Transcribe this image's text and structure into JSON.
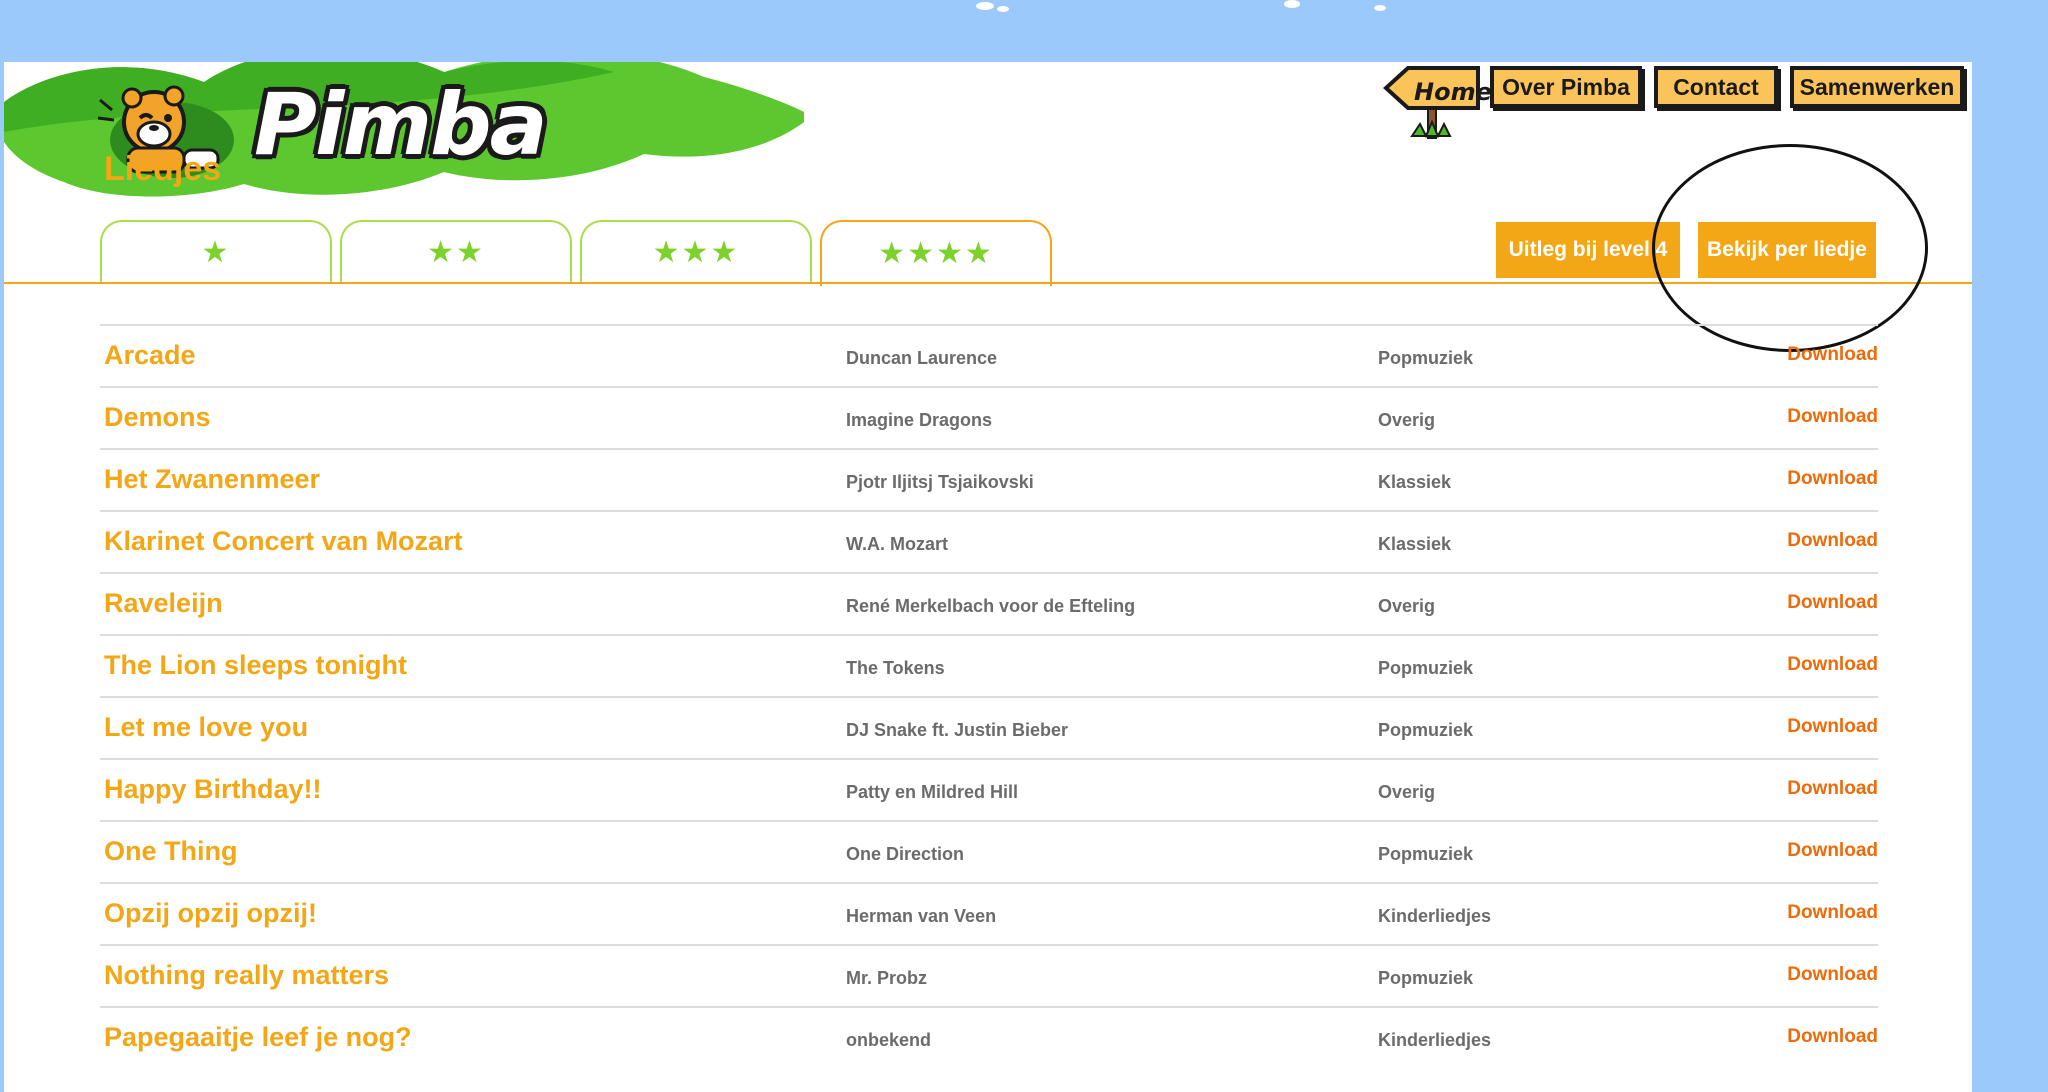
{
  "site": {
    "logo_text": "Pimba"
  },
  "nav": {
    "home_label": "Home",
    "items": [
      {
        "label": "Over Pimba"
      },
      {
        "label": "Contact"
      },
      {
        "label": "Samenwerken"
      }
    ]
  },
  "page": {
    "title": "Liedjes"
  },
  "tabs": [
    {
      "stars": "★",
      "level": 1
    },
    {
      "stars": "★★",
      "level": 2
    },
    {
      "stars": "★★★",
      "level": 3
    },
    {
      "stars": "★★★★",
      "level": 4,
      "active": true
    }
  ],
  "actions": {
    "explain_label": "Uitleg bij level 4",
    "per_song_label": "Bekijk per liedje"
  },
  "songs": [
    {
      "title": "Arcade",
      "artist": "Duncan Laurence",
      "genre": "Popmuziek",
      "download": "Download"
    },
    {
      "title": "Demons",
      "artist": "Imagine Dragons",
      "genre": "Overig",
      "download": "Download"
    },
    {
      "title": "Het Zwanenmeer",
      "artist": "Pjotr Iljitsj Tsjaikovski",
      "genre": "Klassiek",
      "download": "Download"
    },
    {
      "title": "Klarinet Concert van Mozart",
      "artist": "W.A. Mozart",
      "genre": "Klassiek",
      "download": "Download"
    },
    {
      "title": "Raveleijn",
      "artist": "René Merkelbach voor de Efteling",
      "genre": "Overig",
      "download": "Download"
    },
    {
      "title": "The Lion sleeps tonight",
      "artist": "The Tokens",
      "genre": "Popmuziek",
      "download": "Download"
    },
    {
      "title": "Let me love you",
      "artist": "DJ Snake ft. Justin Bieber",
      "genre": "Popmuziek",
      "download": "Download"
    },
    {
      "title": "Happy Birthday!!",
      "artist": "Patty en Mildred Hill",
      "genre": "Overig",
      "download": "Download"
    },
    {
      "title": "One Thing",
      "artist": "One Direction",
      "genre": "Popmuziek",
      "download": "Download"
    },
    {
      "title": "Opzij opzij opzij!",
      "artist": "Herman van Veen",
      "genre": "Kinderliedjes",
      "download": "Download"
    },
    {
      "title": "Nothing really matters",
      "artist": "Mr. Probz",
      "genre": "Popmuziek",
      "download": "Download"
    },
    {
      "title": "Papegaaitje leef je nog?",
      "artist": "onbekend",
      "genre": "Kinderliedjes",
      "download": "Download"
    }
  ],
  "colors": {
    "accent": "#f3a616",
    "download": "#ee6b0a",
    "star": "#7cd12a",
    "sky": "#9cc9fb"
  }
}
